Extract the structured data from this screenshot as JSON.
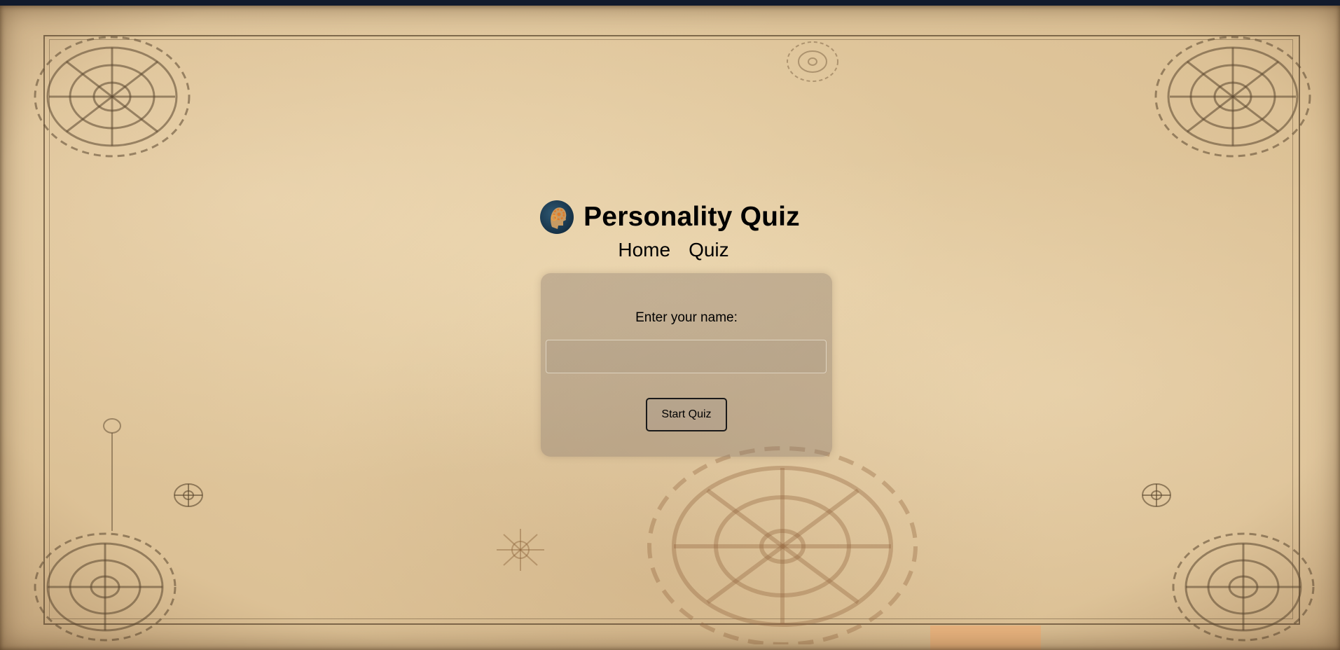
{
  "header": {
    "title": "Personality Quiz",
    "nav": [
      {
        "label": "Home"
      },
      {
        "label": "Quiz"
      }
    ]
  },
  "form": {
    "name_label": "Enter your name:",
    "name_value": "",
    "name_placeholder": "",
    "start_button_label": "Start Quiz"
  },
  "icons": {
    "logo": "brain-gear-head-logo-icon",
    "decor": [
      "gear-icon"
    ]
  },
  "colors": {
    "background": "#e6cfa6",
    "text": "#000000",
    "card": "#8c7d6e"
  }
}
